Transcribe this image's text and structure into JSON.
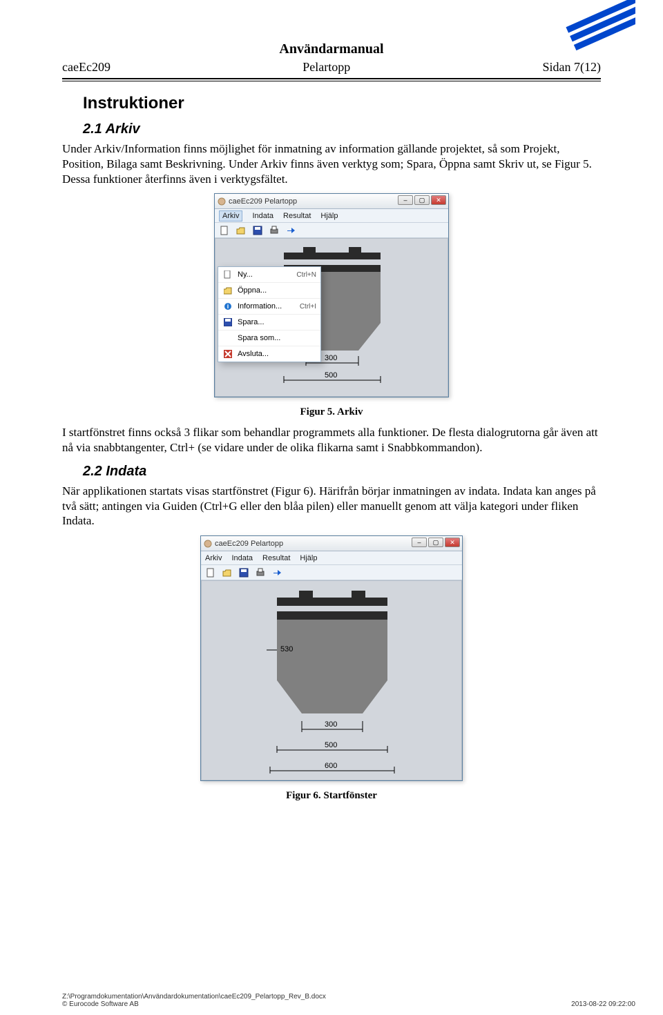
{
  "doc": {
    "title": "Användarmanual",
    "header_left": "caeEc209",
    "header_mid": "Pelartopp",
    "header_right": "Sidan 7(12)",
    "h2": "Instruktioner",
    "s21_title": "2.1  Arkiv",
    "s21_p1": "Under Arkiv/Information finns möjlighet för inmatning av information gällande projektet, så som Projekt, Position, Bilaga samt Beskrivning. Under Arkiv finns även verktyg som; Spara, Öppna samt Skriv ut, se Figur 5. Dessa funktioner återfinns även i verktygsfältet.",
    "fig5_caption": "Figur 5. Arkiv",
    "s21_p2": "I startfönstret finns också 3 flikar som behandlar programmets alla funktioner. De flesta dialogrutorna går även att nå via snabbtangenter, Ctrl+ (se vidare under de olika flikarna samt i Snabbkommandon).",
    "s22_title": "2.2  Indata",
    "s22_p1": "När applikationen startats visas startfönstret (Figur 6). Härifrån börjar inmatningen av indata. Indata kan anges på två sätt; antingen via Guiden (Ctrl+G eller den blåa pilen) eller manuellt genom att välja kategori under fliken Indata.",
    "fig6_caption": "Figur 6. Startfönster"
  },
  "win": {
    "title": "caeEc209 Pelartopp",
    "menus": [
      "Arkiv",
      "Indata",
      "Resultat",
      "Hjälp"
    ],
    "dropdown": [
      {
        "icon": "new",
        "label": "Ny...",
        "shortcut": "Ctrl+N"
      },
      {
        "icon": "open",
        "label": "Öppna...",
        "shortcut": ""
      },
      {
        "icon": "info",
        "label": "Information...",
        "shortcut": "Ctrl+I"
      },
      {
        "icon": "save",
        "label": "Spara...",
        "shortcut": ""
      },
      {
        "icon": "saveas",
        "label": "Spara som...",
        "shortcut": ""
      },
      {
        "icon": "exit",
        "label": "Avsluta...",
        "shortcut": ""
      }
    ]
  },
  "dims": {
    "inner": "300",
    "outer": "500",
    "side_fig2": "530",
    "bottom_fig2": "600"
  },
  "footer": {
    "path": "Z:\\Programdokumentation\\Användardokumentation\\caeEc209_Pelartopp_Rev_B.docx",
    "copy": "© Eurocode Software AB",
    "date": "2013-08-22 09:22:00"
  }
}
